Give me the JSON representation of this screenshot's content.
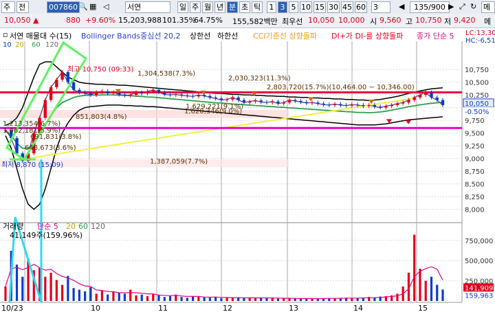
{
  "toolbar": {
    "tab_label": "주",
    "seg1": "전",
    "code": "007860",
    "name": "서연",
    "periods": [
      "일",
      "주",
      "월",
      "년",
      "분",
      "초",
      "틱"
    ],
    "selected_period": "분",
    "intervals": [
      "1",
      "3",
      "5",
      "10",
      "15",
      "30",
      "45",
      "60"
    ],
    "selected_interval": "3",
    "interval_select": "3",
    "page_count": "135/900",
    "search_label": "메"
  },
  "quote": {
    "price": "10,050",
    "change": "880",
    "change_pct": "+9.60%",
    "volume": "15,203,988",
    "ratio": "101.35%",
    "turnover": "64.75%",
    "amount": "155,582백만",
    "broker_label": "최우선",
    "best_price": "10,050",
    "best_ask": "10,000",
    "open_label": "시",
    "open": "9,560",
    "high_label": "고",
    "high": "10,750",
    "low_label": "저",
    "low": "9,420",
    "extra": "메"
  },
  "legend": {
    "name": "서연 매물대 수(15)",
    "bb": "Bollinger Bands중심선 20,2",
    "upper": "상한선",
    "lower": "하한선",
    "cci": "CCI기준선 상향돌파",
    "dmi": "DI+가 DI-를 상향돌파",
    "ma": "종가 단순 5",
    "lc": "LC:13,30",
    "hc": "HC:-6,51",
    "ma_periods": [
      "10",
      "20",
      "60",
      "120"
    ]
  },
  "annotations": {
    "high_mark": "최고 10,750 (09:33)",
    "low_mark": "최저 8,870 (15:09)",
    "vp": [
      "1,304,538(7.3%)",
      "2,030,323(11.3%)",
      "2,803,720(15.7%)(10,464.00 ~ 10,346.00)",
      "1,629,221(9.1%)",
      "1,620,346(9.0%)",
      "851,803(4.8%)",
      "691,831(3.8%)",
      "648,673(3.6%)",
      "1,387,059(7.7%)",
      "1,213,354(6.7%)",
      "1,062,181(5.9%)"
    ],
    "price_tag": "10,050",
    "pct_tag": "-0.50%",
    "vol_tag": "141,909",
    "vol_tag2": "159,963",
    "vol_title": "거래량",
    "vol_ma": "단순 5",
    "vol_ma_periods": [
      "20",
      "60",
      "120"
    ],
    "vol_note": "41,149주(159.96%)"
  },
  "chart_data": {
    "type": "line",
    "y_ticks": [
      "10,750",
      "10,500",
      "10,250",
      "10,000",
      "9,750",
      "9,500",
      "9,250",
      "9,000",
      "8,750",
      "8,500",
      "8,250",
      "8,000"
    ],
    "vol_ticks": [
      "750,000",
      "500,000",
      "250,000"
    ],
    "x_labels": [
      "10/23",
      "10",
      "11",
      "12",
      "13",
      "14",
      "15"
    ],
    "price_axis": [
      7900,
      10900
    ],
    "vol_axis": [
      0,
      850000
    ],
    "close": [
      9560,
      9400,
      9100,
      8950,
      9100,
      9500,
      9800,
      10150,
      10400,
      10550,
      10700,
      10500,
      10350,
      10300,
      10280,
      10250,
      10300,
      10320,
      10280,
      10300,
      10260,
      10240,
      10250,
      10300,
      10280,
      10320,
      10350,
      10300,
      10260,
      10250,
      10260,
      10240,
      10230,
      10220,
      10250,
      10230,
      10200,
      10180,
      10150,
      10160,
      10200,
      10150,
      10100,
      10120,
      10140,
      10110,
      10100,
      10120,
      10080,
      10100,
      10150,
      10130,
      10110,
      10090,
      10100,
      10080,
      10060,
      10050,
      10070,
      10050,
      10040,
      10060,
      10050,
      10030,
      10050,
      10020,
      10000,
      10030,
      10050,
      10080,
      10100,
      10150,
      10200,
      10250,
      10300,
      10200,
      10150,
      10050
    ],
    "upper": [
      9650,
      9700,
      9800,
      10000,
      10300,
      10600,
      10850,
      10900,
      10900,
      10800,
      10700,
      10600,
      10550,
      10500,
      10480,
      10470,
      10460,
      10460,
      10450,
      10450,
      10440,
      10440,
      10430,
      10420,
      10410,
      10400,
      10390,
      10380,
      10370,
      10360,
      10350,
      10340,
      10330,
      10320,
      10310,
      10300,
      10290,
      10280,
      10280,
      10270,
      10260,
      10260,
      10250,
      10250,
      10240,
      10240,
      10230,
      10230,
      10220,
      10220,
      10210,
      10210,
      10200,
      10200,
      10190,
      10190,
      10180,
      10180,
      10170,
      10170,
      10160,
      10160,
      10150,
      10150,
      10140,
      10150,
      10160,
      10180,
      10200,
      10220,
      10250,
      10280,
      10300,
      10330,
      10350,
      10370,
      10380,
      10390
    ],
    "lower": [
      9450,
      9200,
      8800,
      8400,
      8100,
      8000,
      8100,
      8400,
      8800,
      9200,
      9500,
      9700,
      9850,
      9950,
      10000,
      10020,
      10030,
      10040,
      10050,
      10050,
      10050,
      10040,
      10040,
      10030,
      10030,
      10020,
      10020,
      10010,
      10000,
      9990,
      9980,
      9970,
      9960,
      9950,
      9940,
      9930,
      9920,
      9910,
      9900,
      9890,
      9880,
      9870,
      9860,
      9850,
      9840,
      9830,
      9820,
      9810,
      9800,
      9790,
      9780,
      9770,
      9760,
      9750,
      9740,
      9730,
      9720,
      9710,
      9700,
      9690,
      9680,
      9670,
      9660,
      9660,
      9660,
      9660,
      9670,
      9680,
      9700,
      9720,
      9740,
      9760,
      9770,
      9780,
      9790,
      9800,
      9810,
      9820
    ],
    "volume": [
      180000,
      620000,
      450000,
      300000,
      520000,
      380000,
      410000,
      300000,
      350000,
      260000,
      200000,
      310000,
      160000,
      140000,
      120000,
      170000,
      90000,
      130000,
      80000,
      110000,
      100000,
      90000,
      140000,
      70000,
      80000,
      60000,
      90000,
      70000,
      50000,
      60000,
      80000,
      50000,
      40000,
      60000,
      50000,
      45000,
      40000,
      50000,
      35000,
      45000,
      40000,
      38000,
      36000,
      40000,
      42000,
      38000,
      35000,
      36000,
      30000,
      32000,
      35000,
      30000,
      28000,
      30000,
      32000,
      30000,
      35000,
      33000,
      31000,
      36000,
      40000,
      38000,
      35000,
      42000,
      50000,
      45000,
      55000,
      60000,
      70000,
      90000,
      180000,
      350000,
      820000,
      400000,
      250000,
      300000,
      200000,
      141909
    ]
  },
  "colors": {
    "up": "#e0001a",
    "down": "#0b3bd0",
    "bb_mid": "#2aa04a",
    "bb_band": "#000000",
    "ma5": "#d06a00",
    "hline_red": "#e8003a",
    "hline_magenta": "#e800c8",
    "highlight": "#5cf55c",
    "cyan": "#2ed8f0",
    "yellow": "#f0f040"
  }
}
